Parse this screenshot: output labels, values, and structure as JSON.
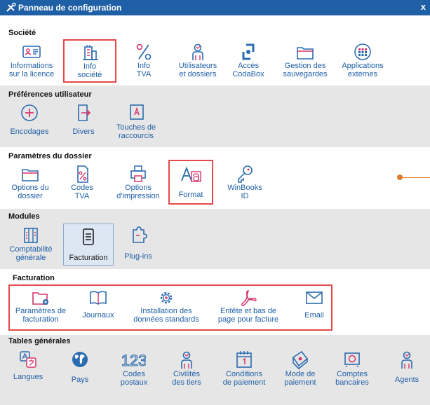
{
  "window": {
    "title": "Panneau de configuration",
    "close_label": "x"
  },
  "sections": {
    "societe": {
      "title": "Société",
      "items": [
        {
          "label": "Informations\nsur la licence",
          "icon": "license-card-icon"
        },
        {
          "label": "Info\nsociété",
          "icon": "building-icon"
        },
        {
          "label": "Info\nTVA",
          "icon": "percent-icon"
        },
        {
          "label": "Utilisateurs\net dossiers",
          "icon": "users-icon"
        },
        {
          "label": "Accès\nCodaBox",
          "icon": "codabox-icon"
        },
        {
          "label": "Gestion des\nsauvegardes",
          "icon": "folder-icon"
        },
        {
          "label": "Applications\nexternes",
          "icon": "apps-grid-icon"
        }
      ]
    },
    "preferences": {
      "title": "Préférences utilisateur",
      "items": [
        {
          "label": "Encodages",
          "icon": "plus-circle-icon"
        },
        {
          "label": "Divers",
          "icon": "export-doc-icon"
        },
        {
          "label": "Touches de\nraccourcis",
          "icon": "keyboard-key-icon"
        }
      ]
    },
    "parametres": {
      "title": "Paramètres du dossier",
      "items": [
        {
          "label": "Options du\ndossier",
          "icon": "folder-icon"
        },
        {
          "label": "Codes\nTVA",
          "icon": "vat-doc-icon"
        },
        {
          "label": "Options\nd'impression",
          "icon": "printer-icon"
        },
        {
          "label": "Format",
          "icon": "font-format-icon"
        },
        {
          "label": "WinBooks\nID",
          "icon": "key-icon"
        }
      ]
    },
    "modules": {
      "title": "Modules",
      "items": [
        {
          "label": "Comptabilité\ngénérale",
          "icon": "ledger-icon"
        },
        {
          "label": "Facturation",
          "icon": "invoice-icon"
        },
        {
          "label": "Plug-ins",
          "icon": "plugin-icon"
        }
      ]
    },
    "facturation": {
      "title": "Facturation",
      "items": [
        {
          "label": "Paramètres de\nfacturation",
          "icon": "folder-gear-icon"
        },
        {
          "label": "Journaux",
          "icon": "book-icon"
        },
        {
          "label": "Installation des\ndonnées standards",
          "icon": "gear-icon"
        },
        {
          "label": "Entête et bas de\npage pour facture",
          "icon": "pdf-icon"
        },
        {
          "label": "Email",
          "icon": "envelope-icon"
        }
      ]
    },
    "tables": {
      "title": "Tables générales",
      "items": [
        {
          "label": "Langues",
          "icon": "language-icon"
        },
        {
          "label": "Pays",
          "icon": "globe-icon"
        },
        {
          "label": "Codes\npostaux",
          "icon": "numbers-123-icon"
        },
        {
          "label": "Civilités\ndes tiers",
          "icon": "person-icon"
        },
        {
          "label": "Conditions\nde paiement",
          "icon": "calendar-icon"
        },
        {
          "label": "Mode de\npaiement",
          "icon": "wallet-icon"
        },
        {
          "label": "Comptes\nbancaires",
          "icon": "bank-card-icon"
        },
        {
          "label": "Agents",
          "icon": "person-icon"
        }
      ]
    }
  },
  "colors": {
    "titlebar": "#1f5fa6",
    "label": "#1f5fa6",
    "highlight": "#e54848",
    "icon_blue": "#2b6cb0",
    "icon_pink": "#d6336c"
  }
}
